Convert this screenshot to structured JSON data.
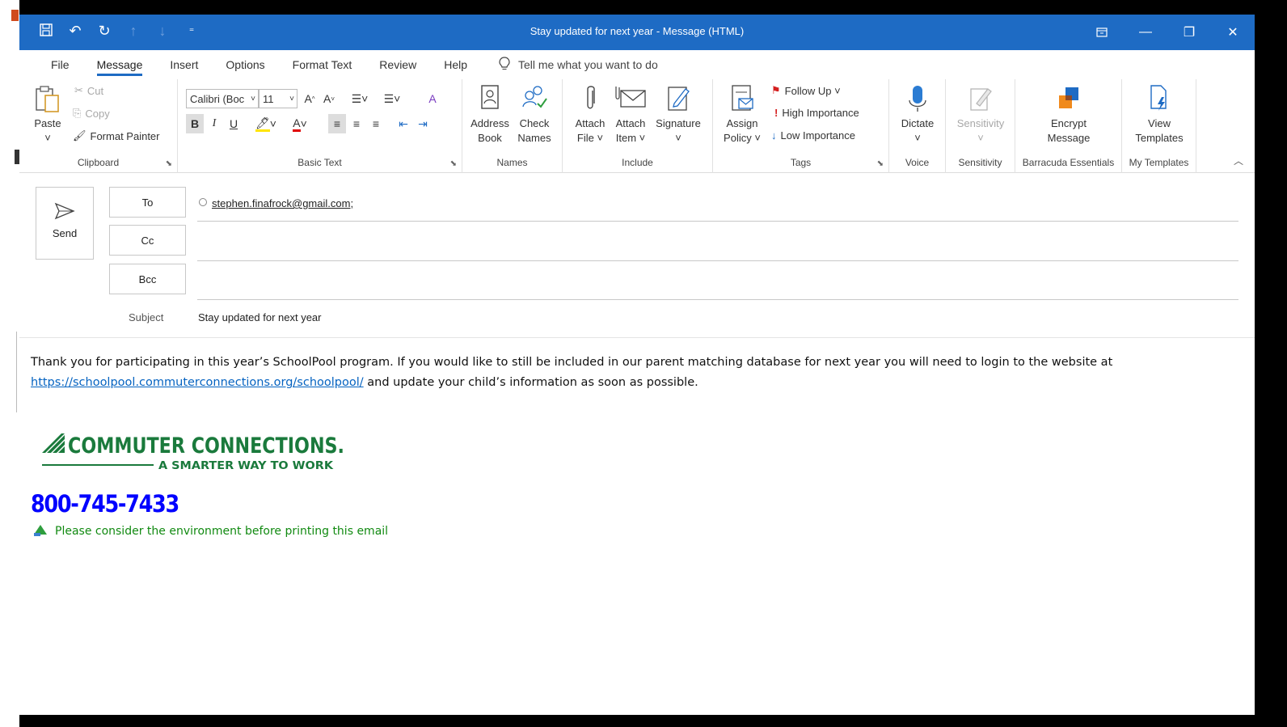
{
  "window": {
    "title": "Stay updated for next year  -  Message (HTML)"
  },
  "tabs": [
    "File",
    "Message",
    "Insert",
    "Options",
    "Format Text",
    "Review",
    "Help"
  ],
  "tell_me": "Tell me what you want to do",
  "ribbon": {
    "clipboard": {
      "paste": "Paste",
      "cut": "Cut",
      "copy": "Copy",
      "format_painter": "Format Painter",
      "label": "Clipboard"
    },
    "basic_text": {
      "font": "Calibri (Boc",
      "size": "11",
      "label": "Basic Text"
    },
    "names": {
      "address_book": [
        "Address",
        "Book"
      ],
      "check_names": [
        "Check",
        "Names"
      ],
      "label": "Names"
    },
    "include": {
      "attach_file": [
        "Attach",
        "File ˅"
      ],
      "attach_item": [
        "Attach",
        "Item ˅"
      ],
      "signature": [
        "Signature",
        "˅"
      ],
      "label": "Include"
    },
    "tags": {
      "assign_policy": [
        "Assign",
        "Policy ˅"
      ],
      "follow_up": "Follow Up ˅",
      "high_importance": "High Importance",
      "low_importance": "Low Importance",
      "label": "Tags"
    },
    "voice": {
      "dictate": [
        "Dictate",
        "˅"
      ],
      "label": "Voice"
    },
    "sensitivity": {
      "sensitivity": [
        "Sensitivity",
        "˅"
      ],
      "label": "Sensitivity"
    },
    "barracuda": {
      "encrypt": [
        "Encrypt",
        "Message"
      ],
      "label": "Barracuda Essentials"
    },
    "templates": {
      "view": [
        "View",
        "Templates"
      ],
      "label": "My Templates"
    }
  },
  "compose": {
    "send": "Send",
    "to": "To",
    "cc": "Cc",
    "bcc": "Bcc",
    "subject_label": "Subject",
    "to_value": "stephen.finafrock@gmail.com;",
    "subject_value": "Stay updated for next year"
  },
  "body": {
    "text1": "Thank you for participating in this year’s SchoolPool program.  If you would like to still be included in our parent matching database for next year you will need to login to the website at",
    "link": "https://schoolpool.commuterconnections.org/schoolpool/",
    "text2": " and update your child’s information as soon as possible.",
    "logo_main": "COMMUTER CONNECTIONS.",
    "logo_tagline": "A SMARTER WAY TO WORK",
    "phone": "800-745-7433",
    "environment": "Please consider the environment before printing this email"
  },
  "colors": {
    "accent": "#1e6bc4",
    "logo_green": "#1a7a3c",
    "phone_blue": "#0000ff",
    "env_green": "#118a11",
    "link": "#0563c1"
  }
}
